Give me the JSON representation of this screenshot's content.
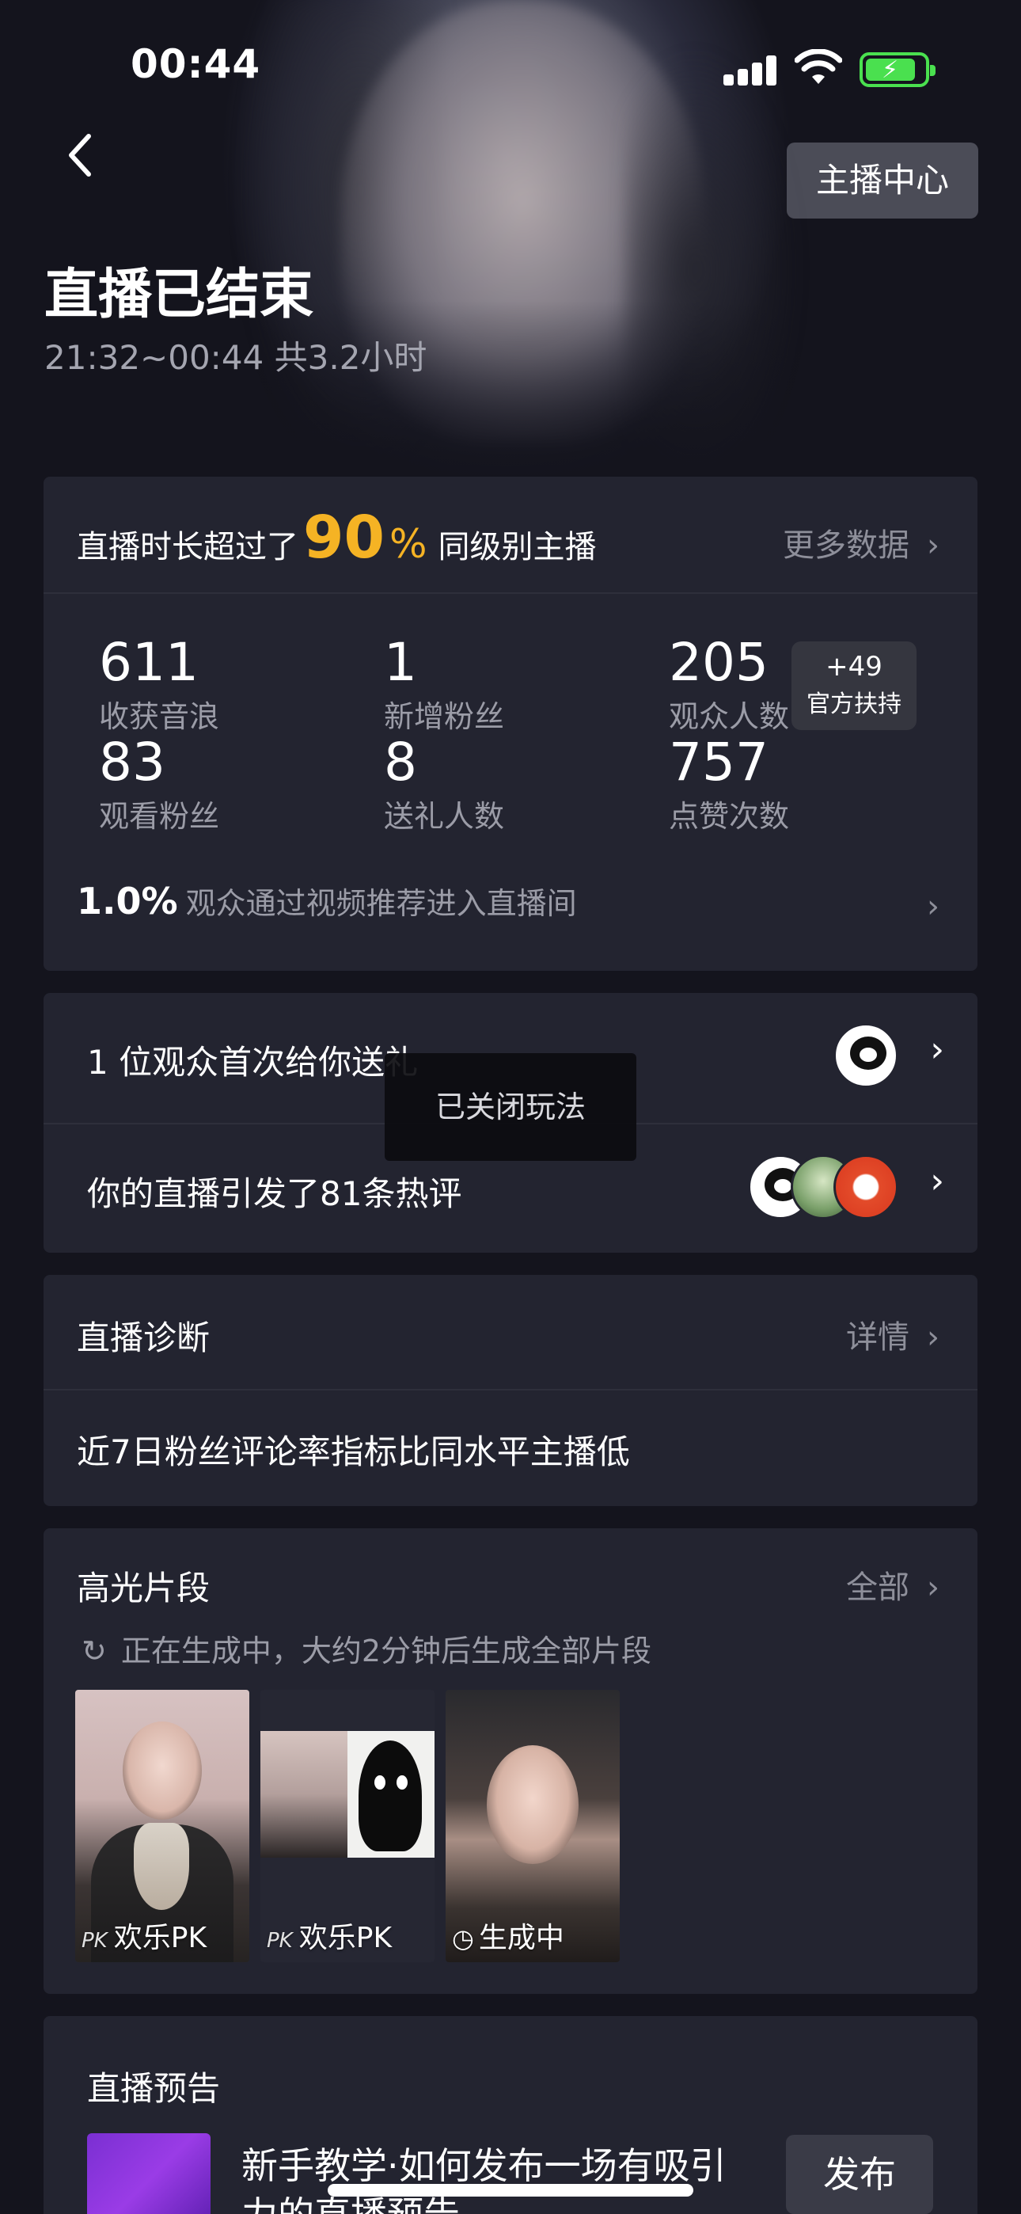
{
  "status_bar": {
    "time": "00:44"
  },
  "header": {
    "anchor_center": "主播中心",
    "title": "直播已结束",
    "subtitle": "21:32~00:44 共3.2小时"
  },
  "summary_card": {
    "prefix": "直播时长超过了",
    "percent": "90",
    "percent_sign": "%",
    "suffix": "同级别主播",
    "more_data": "更多数据",
    "stats": [
      {
        "value": "611",
        "label": "收获音浪"
      },
      {
        "value": "1",
        "label": "新增粉丝"
      },
      {
        "value": "205",
        "label": "观众人数"
      },
      {
        "value": "83",
        "label": "观看粉丝"
      },
      {
        "value": "8",
        "label": "送礼人数"
      },
      {
        "value": "757",
        "label": "点赞次数"
      }
    ],
    "support_badge": {
      "count": "+49",
      "label": "官方扶持"
    },
    "recommend": {
      "rate": "1.0%",
      "text": "观众通过视频推荐进入直播间"
    }
  },
  "activity_card": {
    "first_gift": "1 位观众首次给你送礼",
    "hot_comments": "你的直播引发了81条热评"
  },
  "toast": "已关闭玩法",
  "diagnosis_card": {
    "title": "直播诊断",
    "link": "详情",
    "text": "近7日粉丝评论率指标比同水平主播低"
  },
  "highlights_card": {
    "title": "高光片段",
    "link": "全部",
    "status": "正在生成中，大约2分钟后生成全部片段",
    "clips": [
      {
        "tag": "PK",
        "label": "欢乐PK"
      },
      {
        "tag": "PK",
        "label": "欢乐PK"
      },
      {
        "tag": "clock-icon",
        "label": "生成中"
      }
    ]
  },
  "preview_card": {
    "title": "直播预告",
    "text": "新手教学·如何发布一场有吸引力的直播预告",
    "publish": "发布"
  },
  "colors": {
    "accent": "#f5b324",
    "background": "#14141d",
    "card": "#232430"
  }
}
